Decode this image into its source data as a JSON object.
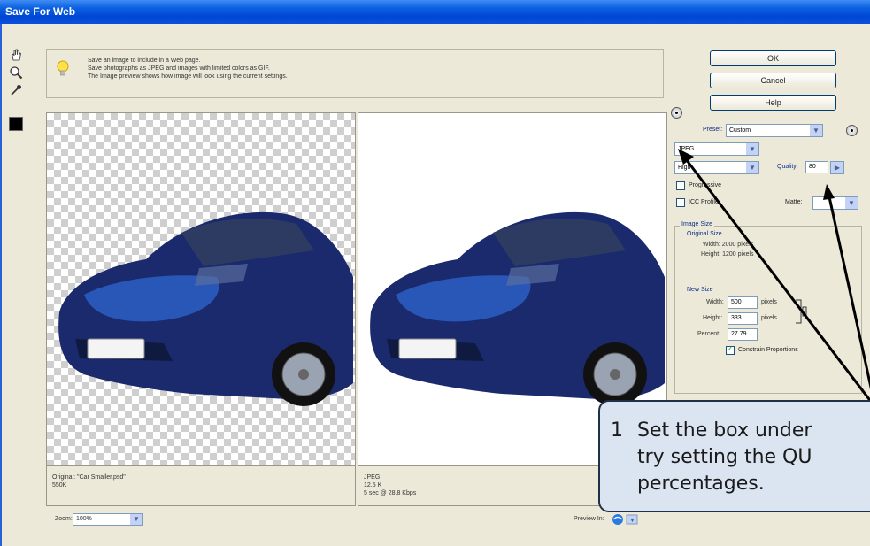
{
  "window": {
    "title": "Save For Web"
  },
  "tools": [
    "hand-icon",
    "zoom-icon",
    "eyedropper-icon"
  ],
  "tips": {
    "lines": [
      "Save an image to include in a Web page.",
      "Save photographs as JPEG and images with limited colors as GIF.",
      "The Image preview shows how image will look using the current settings."
    ]
  },
  "original_pane": {
    "line1": "Original: \"Car Smaller.psd\"",
    "line2": "550K"
  },
  "optimized_pane": {
    "line1": "JPEG",
    "line2": "12.5 K",
    "line3": "5 sec @ 28.8 Kbps"
  },
  "buttons": {
    "ok": "OK",
    "cancel": "Cancel",
    "help": "Help"
  },
  "settings": {
    "preset_label": "Preset:",
    "preset_value": "Custom",
    "format_value": "JPEG",
    "quality_level": "High",
    "quality_label": "Quality:",
    "quality_value": "80",
    "progressive_label": "Progressive",
    "icc_label": "ICC Profile",
    "matte_label": "Matte:"
  },
  "image_size": {
    "title": "Image Size",
    "original_title": "Original Size",
    "orig_width": "Width: 2000 pixels",
    "orig_height": "Height: 1200 pixels",
    "new_title": "New Size",
    "width_label": "Width:",
    "width_value": "500",
    "height_label": "Height:",
    "height_value": "333",
    "percent_label": "Percent:",
    "percent_value": "27.79",
    "pixels": "pixels",
    "constrain_label": "Constrain Proportions"
  },
  "bottom": {
    "zoom_label": "Zoom:",
    "zoom_value": "100%",
    "preview_label": "Preview In:"
  },
  "callout": {
    "line1": "Set the box under",
    "line2": "try setting the QU",
    "line3": "percentages.",
    "step_number": "1"
  },
  "colors": {
    "title_bar": "#0a5fe0",
    "dialog_bg": "#ece9d8",
    "callout_bg": "#dbe4f1",
    "car_body": "#1a2a6c"
  }
}
